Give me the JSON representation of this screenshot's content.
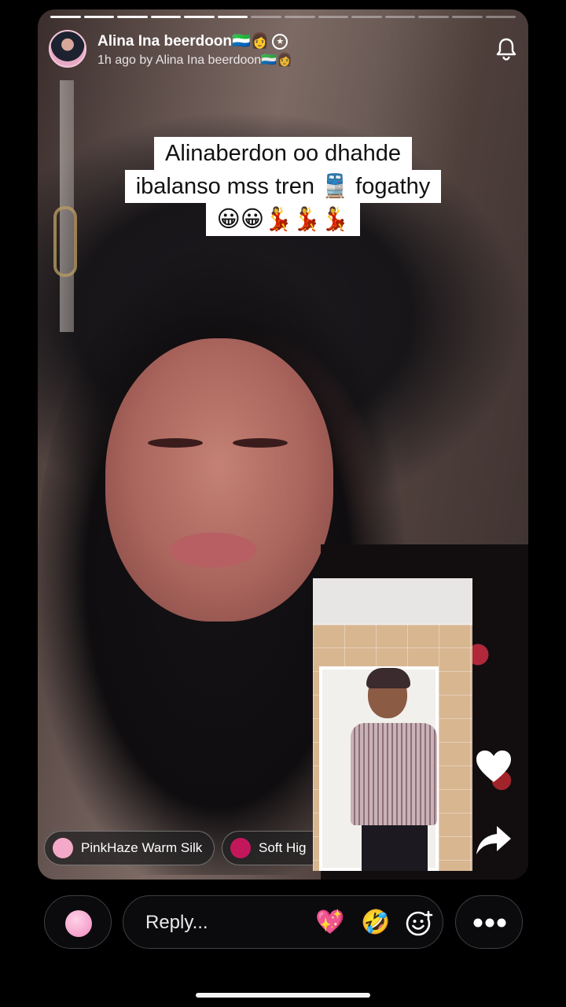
{
  "story": {
    "progress": {
      "segments": 14,
      "completed": 6
    },
    "user": {
      "name": "Alina Ina beerdoon🇸🇱👩",
      "badge_icon": "star-badge-icon",
      "subtitle": "1h ago by Alina Ina beerdoon🇸🇱👩"
    },
    "header_icon": "bell-icon",
    "caption": [
      "Alinaberdon oo  dhahde",
      "ibalanso mss tren 🚆 fogathy",
      "😀😀💃💃💃"
    ],
    "actions": {
      "like_icon": "heart-icon",
      "share_icon": "share-arrow-icon"
    },
    "chips": [
      {
        "label": "PinkHaze Warm Silk",
        "color": "#f4a9c8"
      },
      {
        "label": "Soft Hig",
        "color": "#c2185b"
      }
    ]
  },
  "reply_bar": {
    "placeholder": "Reply...",
    "emojis": [
      "💖",
      "🤣"
    ],
    "sticker_icon": "add-sticker-icon",
    "more_icon": "more-dots-icon"
  }
}
